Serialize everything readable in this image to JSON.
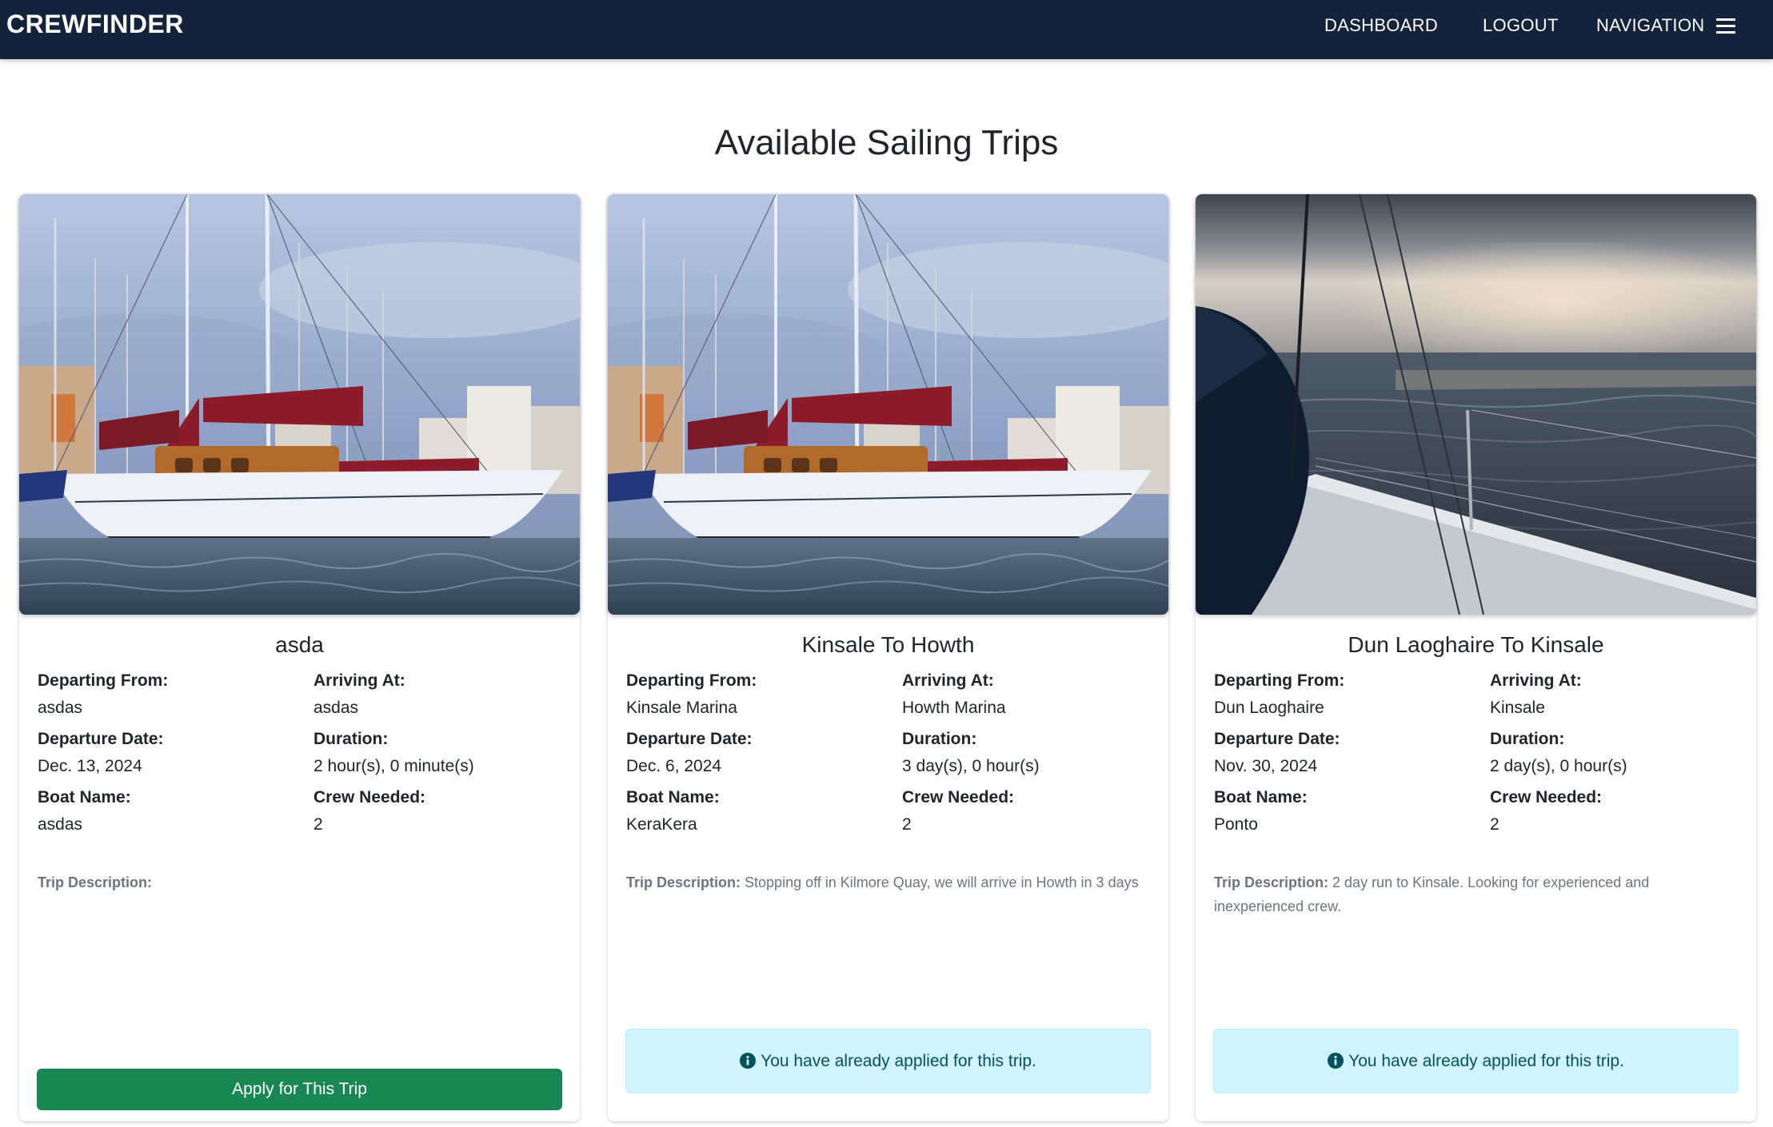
{
  "navbar": {
    "brand": "CREWFINDER",
    "links": {
      "dashboard": "DASHBOARD",
      "logout": "LOGOUT",
      "navigation": "NAVIGATION"
    },
    "icon": "hamburger-menu-icon"
  },
  "page": {
    "title": "Available Sailing Trips"
  },
  "labels": {
    "departing_from": "Departing From:",
    "arriving_at": "Arriving At:",
    "departure_date": "Departure Date:",
    "duration": "Duration:",
    "boat_name": "Boat Name:",
    "crew_needed": "Crew Needed:",
    "trip_description": "Trip Description:"
  },
  "trips": [
    {
      "title": "asda",
      "departing_from": "asdas",
      "arriving_at": "asdas",
      "departure_date": "Dec. 13, 2024",
      "duration": "2 hour(s), 0 minute(s)",
      "boat_name": "asdas",
      "crew_needed": "2",
      "description": "",
      "image": "sailboat-in-marina-photo",
      "action": {
        "button_label": "Apply for This Trip"
      }
    },
    {
      "title": "Kinsale To Howth",
      "departing_from": "Kinsale Marina",
      "arriving_at": "Howth Marina",
      "departure_date": "Dec. 6, 2024",
      "duration": "3 day(s), 0 hour(s)",
      "boat_name": "KeraKera",
      "crew_needed": "2",
      "description": "Stopping off in Kilmore Quay, we will arrive in Howth in 3 days",
      "image": "sailboat-in-marina-photo",
      "action": {
        "alert_text": "You have already applied for this trip.",
        "alert_icon": "info-circle-icon"
      }
    },
    {
      "title": "Dun Laoghaire To Kinsale",
      "departing_from": "Dun Laoghaire",
      "arriving_at": "Kinsale",
      "departure_date": "Nov. 30, 2024",
      "duration": "2 day(s), 0 hour(s)",
      "boat_name": "Ponto",
      "crew_needed": "2",
      "description": "2 day run to Kinsale. Looking for experienced and inexperienced crew.",
      "image": "sailboat-deck-at-sea-photo",
      "action": {
        "alert_text": "You have already applied for this trip.",
        "alert_icon": "info-circle-icon"
      }
    }
  ],
  "colors": {
    "navbar": "#12233b",
    "apply_button": "#198754",
    "alert_background": "#cff4fc",
    "alert_text": "#055160"
  }
}
